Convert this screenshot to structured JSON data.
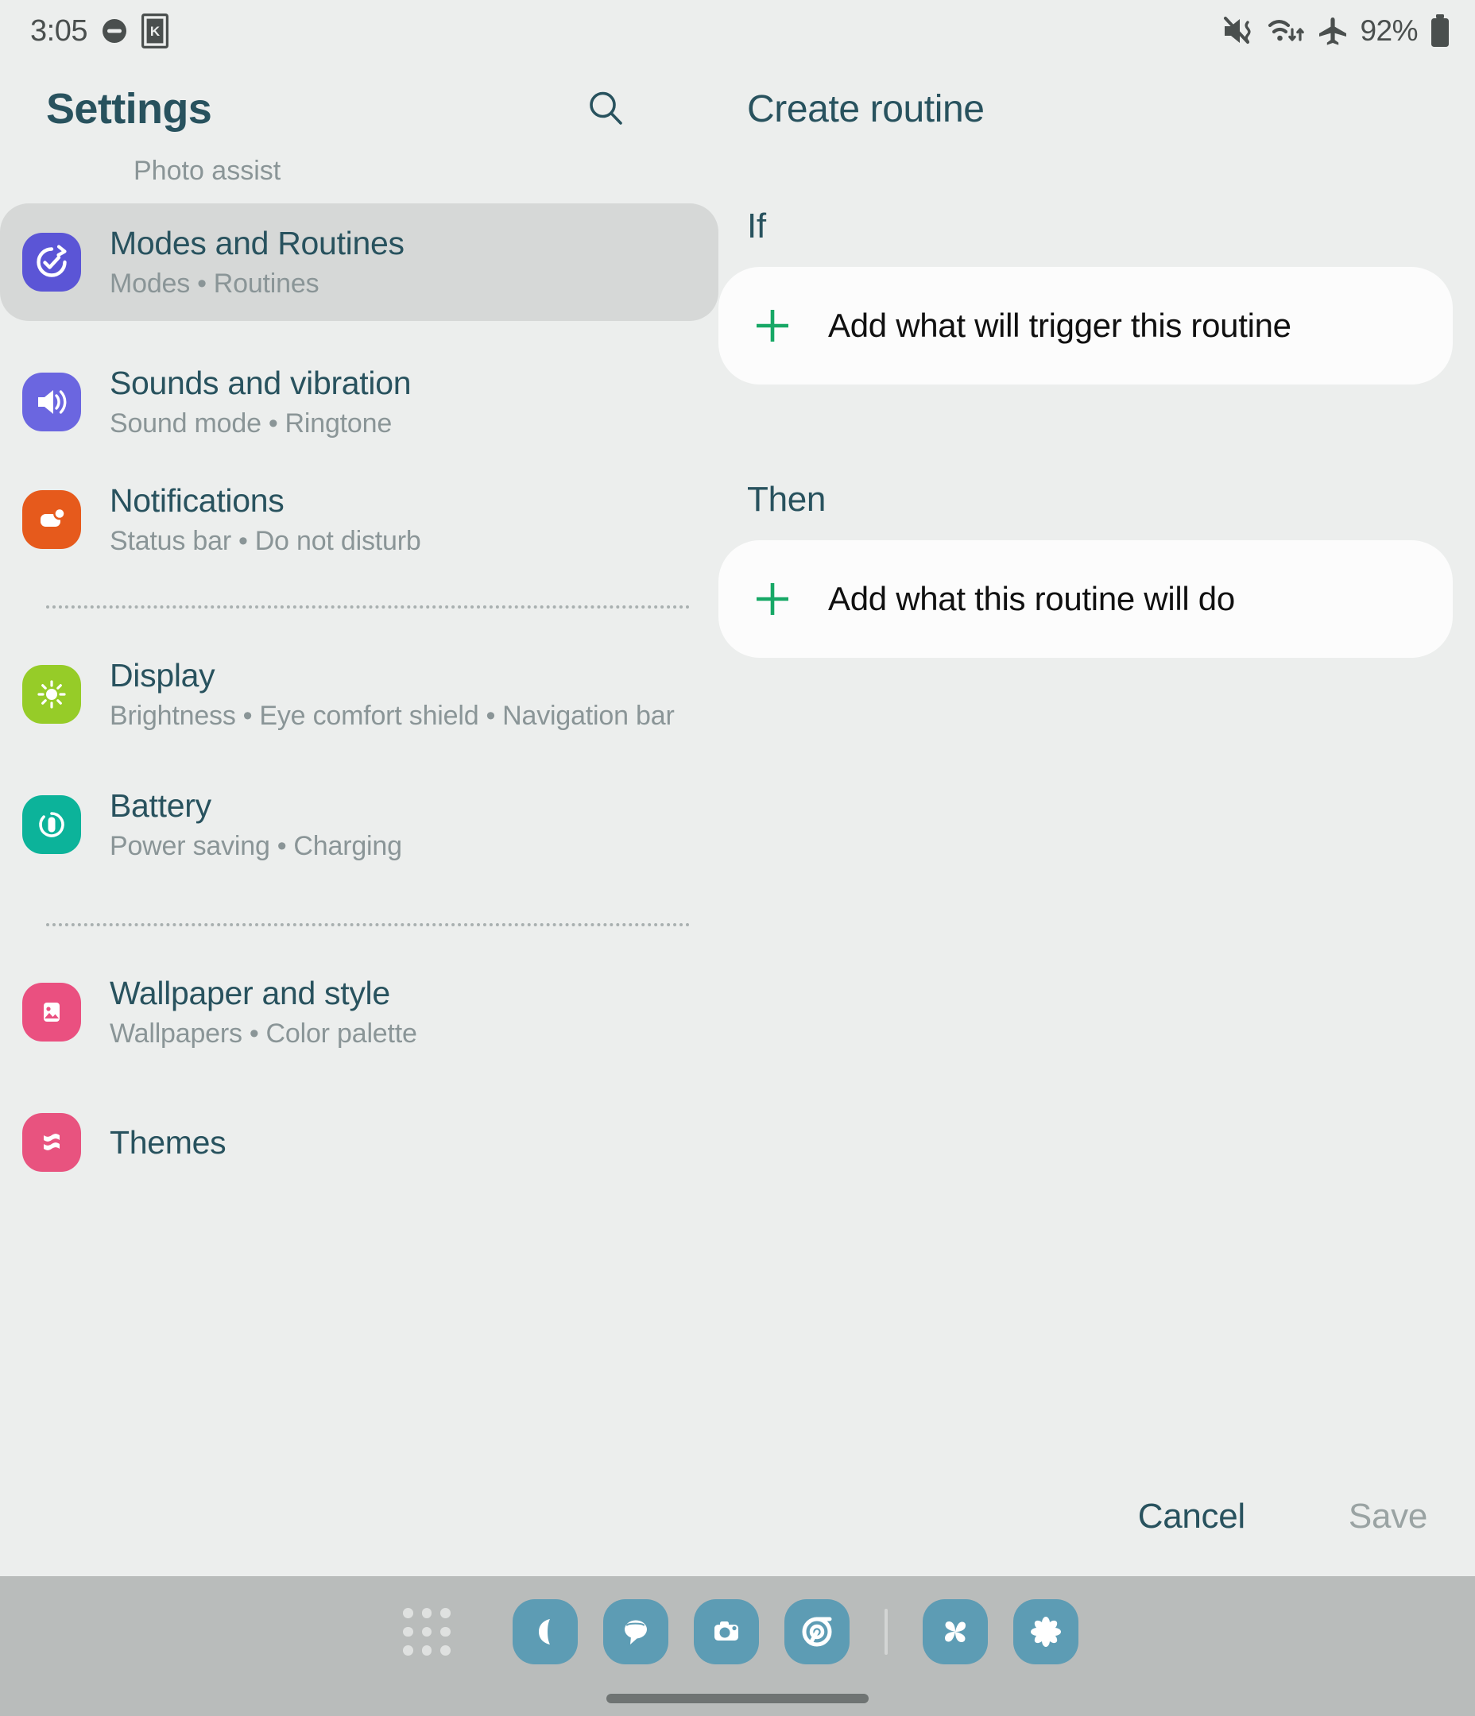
{
  "status_bar": {
    "time": "3:05",
    "left_icons": [
      "dnd-minus-circle-icon",
      "knox-boxed-k-icon"
    ],
    "right_icons": [
      "mute-vibrate-icon",
      "wifi-transfer-icon",
      "airplane-mode-icon"
    ],
    "battery_percent": "92%",
    "battery_icon": "battery-full-icon"
  },
  "sidebar": {
    "title": "Settings",
    "search_icon": "search-icon",
    "partial_top_item": "Photo assist",
    "items": [
      {
        "title": "Modes and Routines",
        "subtitle_parts": [
          "Modes",
          "Routines"
        ],
        "icon": "modes-routines-icon",
        "icon_color": "#5b55d6",
        "selected": true
      },
      {
        "title": "Sounds and vibration",
        "subtitle_parts": [
          "Sound mode",
          "Ringtone"
        ],
        "icon": "speaker-volume-icon",
        "icon_color": "#6b66e0",
        "selected": false
      },
      {
        "title": "Notifications",
        "subtitle_parts": [
          "Status bar",
          "Do not disturb"
        ],
        "icon": "notification-bubble-icon",
        "icon_color": "#e65a1c",
        "selected": false
      },
      {
        "title": "Display",
        "subtitle_parts": [
          "Brightness",
          "Eye comfort shield",
          "Navigation bar"
        ],
        "icon": "sun-brightness-icon",
        "icon_color": "#96cc28",
        "selected": false
      },
      {
        "title": "Battery",
        "subtitle_parts": [
          "Power saving",
          "Charging"
        ],
        "icon": "battery-circle-icon",
        "icon_color": "#0cb39a",
        "selected": false
      },
      {
        "title": "Wallpaper and style",
        "subtitle_parts": [
          "Wallpapers",
          "Color palette"
        ],
        "icon": "image-photo-icon",
        "icon_color": "#ea5080",
        "selected": false
      },
      {
        "title": "Themes",
        "subtitle_parts": [],
        "icon": "themes-icon",
        "icon_color": "#e8537f",
        "selected": false
      }
    ]
  },
  "detail": {
    "title": "Create routine",
    "if_section": {
      "label": "If",
      "add_icon": "plus-icon",
      "add_label": "Add what will trigger this routine"
    },
    "then_section": {
      "label": "Then",
      "add_icon": "plus-icon",
      "add_label": "Add what this routine will do"
    },
    "actions": {
      "cancel_label": "Cancel",
      "save_label": "Save",
      "save_enabled": false
    }
  },
  "taskbar": {
    "app_drawer_icon": "app-grid-icon",
    "apps": [
      {
        "name": "phone-app-icon"
      },
      {
        "name": "messages-app-icon"
      },
      {
        "name": "camera-app-icon"
      },
      {
        "name": "chrome-app-icon"
      }
    ],
    "recent_apps": [
      {
        "name": "pinwheel-app-icon"
      },
      {
        "name": "flower-app-icon"
      }
    ],
    "home_indicator": "home-indicator"
  },
  "colors": {
    "background": "#eceeed",
    "accent_teal": "#28525e",
    "add_plus_green": "#17a866",
    "selected_row": "#d6d8d7",
    "card_white": "#fcfcfc",
    "taskbar": "#b9bcbb",
    "taskbar_icon": "#5d9cb4"
  }
}
